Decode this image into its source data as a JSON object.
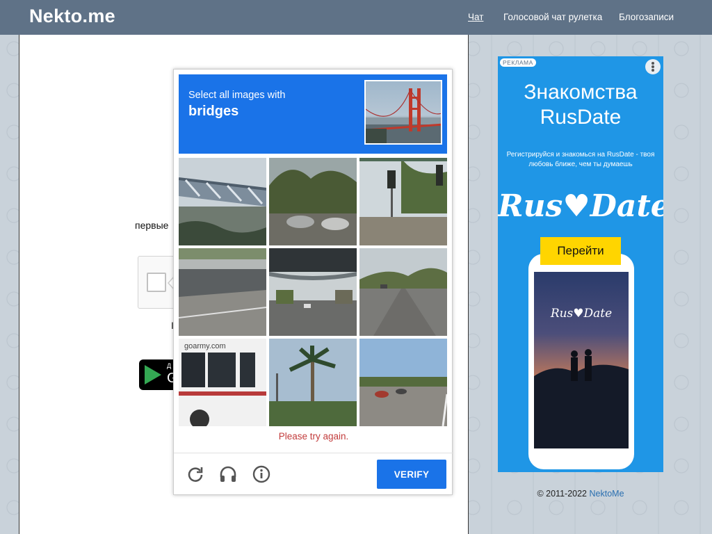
{
  "site": {
    "logo": "Nekto.me",
    "nav": [
      {
        "label": "Чат",
        "active": true
      },
      {
        "label": "Голосовой чат рулетка",
        "active": false
      },
      {
        "label": "Блогозаписи",
        "active": false
      }
    ]
  },
  "main": {
    "partial_text": "первые",
    "partial_text_2": "I",
    "gplay_small": "Д",
    "gplay_big": "G"
  },
  "captcha": {
    "instruction_line1": "Select all images with",
    "instruction_target": "bridges",
    "tiles": [
      {
        "scene": "bridge-overpass"
      },
      {
        "scene": "parking-trees"
      },
      {
        "scene": "traffic-light-street"
      },
      {
        "scene": "bridge-underpass"
      },
      {
        "scene": "bridge-road-underpass"
      },
      {
        "scene": "wide-road"
      },
      {
        "scene": "bus"
      },
      {
        "scene": "palm-trees"
      },
      {
        "scene": "intersection"
      }
    ],
    "error_message": "Please try again.",
    "verify_label": "VERIFY",
    "icons": [
      "reload-icon",
      "audio-icon",
      "info-icon"
    ],
    "accent_color": "#1a73e8"
  },
  "ad": {
    "badge": "РЕКЛАМА",
    "title": "Знакомства RusDate",
    "subtitle": "Регистрируйся и знакомься на RusDate - твоя любовь ближе, чем ты думаешь",
    "logo": "Rus♥Date",
    "button": "Перейти",
    "phone_logo": "Rus♥Date"
  },
  "footer": {
    "copyright": "© 2011-2022",
    "link": "NektoMe"
  }
}
